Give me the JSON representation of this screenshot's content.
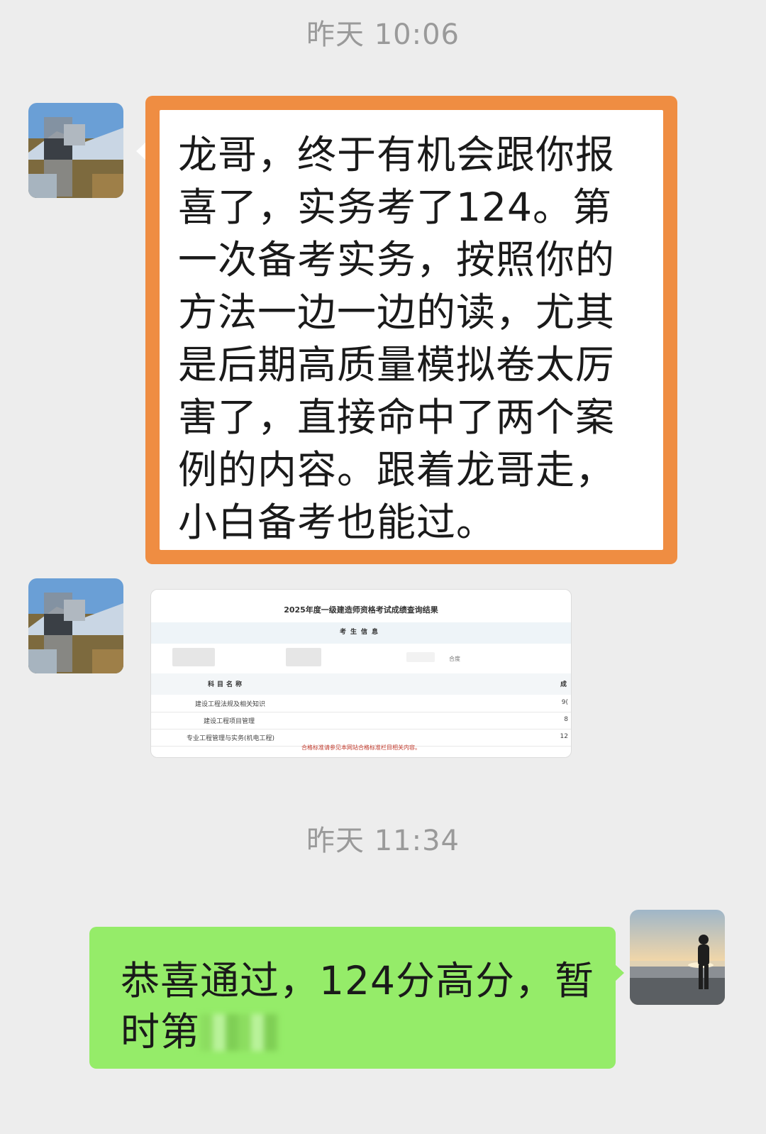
{
  "chat": {
    "timestamps": [
      "昨天 10:06",
      "昨天 11:34"
    ],
    "messages": [
      {
        "sender": "contact",
        "type": "text",
        "text": "龙哥，终于有机会跟你报喜了，实务考了124。第一次备考实务，按照你的方法一边一边的读，尤其是后期高质量模拟卷太厉害了，直接命中了两个案例的内容。跟着龙哥走，小白备考也能过。",
        "highlight_color": "#ef8d42"
      },
      {
        "sender": "contact",
        "type": "image",
        "image": {
          "title": "2025年度一级建造师资格考试成绩查询结果",
          "subtitle": "考生信息",
          "column_subject": "科目名称",
          "column_score": "成",
          "rows": [
            {
              "name": "建设工程法规及相关知识",
              "score": "9("
            },
            {
              "name": "建设工程项目管理",
              "score": "8"
            },
            {
              "name": "专业工程管理与实务(机电工程)",
              "score": "12"
            }
          ],
          "note": "合格标准请参见本网站合格标准栏目相关内容。",
          "side_text": "合度"
        }
      },
      {
        "sender": "me",
        "type": "text",
        "text_line1": "恭喜通过，124分高分，暂",
        "text_line2": "时第",
        "bubble_color": "#95ec69"
      }
    ]
  },
  "icons": [
    "contact-avatar-icon",
    "my-avatar-icon"
  ],
  "colors": {
    "background": "#ededed",
    "timestamp": "#9a9a9a"
  }
}
